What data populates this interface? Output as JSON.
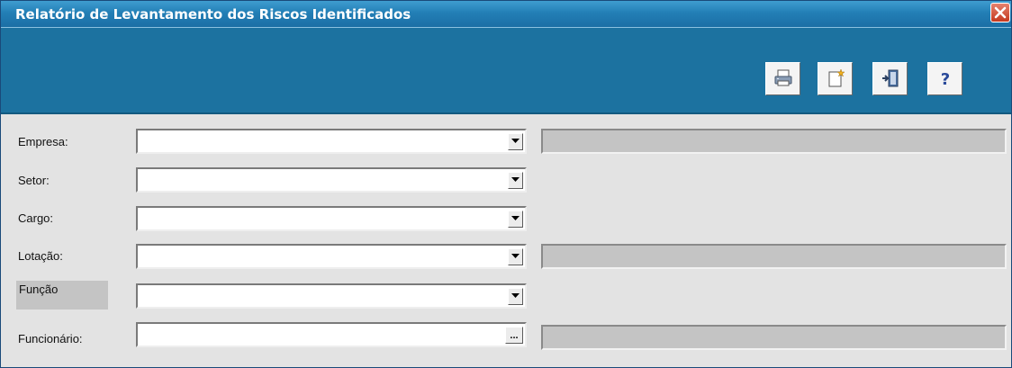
{
  "window": {
    "title": "Relatório de Levantamento dos Riscos Identificados"
  },
  "toolbar": {
    "buttons": [
      {
        "name": "print",
        "icon": "printer-icon"
      },
      {
        "name": "new",
        "icon": "new-document-icon"
      },
      {
        "name": "exit",
        "icon": "exit-door-icon"
      },
      {
        "name": "help",
        "icon": "help-icon",
        "glyph": "?"
      }
    ]
  },
  "form": {
    "empresa_label": "Empresa:",
    "setor_label": "Setor:",
    "cargo_label": "Cargo:",
    "lotacao_label": "Lotação:",
    "funcao_label": "Função",
    "funcionario_label": "Funcionário:",
    "empresa_value": "",
    "setor_value": "",
    "cargo_value": "",
    "lotacao_value": "",
    "funcao_value": "",
    "funcionario_value": "",
    "empresa_desc": "",
    "lotacao_desc": "",
    "funcionario_desc": "",
    "ellipsis_label": "..."
  },
  "colors": {
    "titlebar": "#237fb6",
    "toolbar": "#1c72a0",
    "form_bg": "#e3e3e3",
    "readonly_field": "#c4c4c4",
    "close_button": "#c5391f"
  }
}
